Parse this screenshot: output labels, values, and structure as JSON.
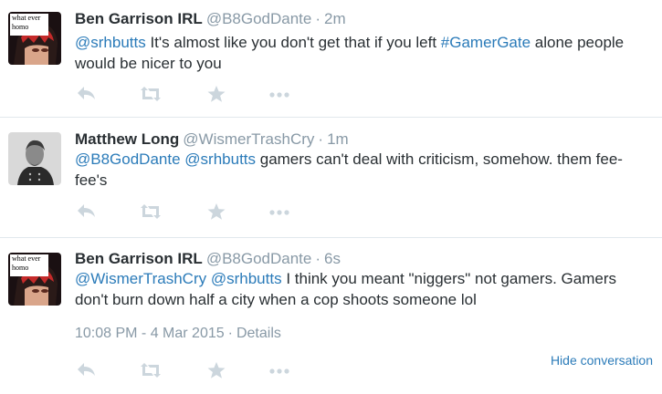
{
  "tweets": [
    {
      "fullname": "Ben Garrison IRL",
      "username": "@B8GodDante",
      "time": "2m",
      "avatar_text": "what ever homo",
      "text_parts": [
        "@srhbutts",
        " It's almost like you don't get that if you left ",
        "#GamerGate",
        " alone people would be nicer to you"
      ]
    },
    {
      "fullname": "Matthew Long",
      "username": "@WismerTrashCry",
      "time": "1m",
      "text_parts": [
        "@B8GodDante",
        " ",
        "@srhbutts",
        " gamers can't deal with criticism, somehow. them fee-fee's"
      ]
    },
    {
      "fullname": "Ben Garrison IRL",
      "username": "@B8GodDante",
      "time": "6s",
      "avatar_text": "what ever homo",
      "text_parts": [
        "@WismerTrashCry",
        " ",
        "@srhbutts",
        " I think you meant \"niggers\" not gamers. Gamers don't burn down half a city when a cop shoots someone lol"
      ],
      "timestamp": "10:08 PM - 4 Mar 2015",
      "details": "Details"
    }
  ],
  "separator": "·",
  "hide_conversation": "Hide conversation",
  "colors": {
    "link": "#2b7bb9",
    "muted": "#8899a6",
    "icon": "#ccd6dd",
    "divider": "#e1e8ed"
  }
}
